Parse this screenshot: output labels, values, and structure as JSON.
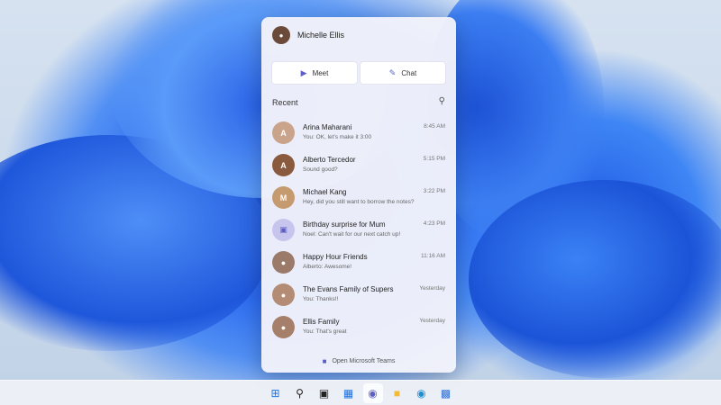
{
  "profile": {
    "name": "Michelle Ellis",
    "avatar_icon": "user-avatar-icon"
  },
  "actions": {
    "meet_label": "Meet",
    "meet_icon": "video-camera-icon",
    "chat_label": "Chat",
    "chat_icon": "compose-icon"
  },
  "recent": {
    "label": "Recent",
    "search_icon": "search-icon"
  },
  "conversations": [
    {
      "title": "Arina Maharani",
      "preview": "You: OK, let's make it 3:00",
      "time": "8:45 AM",
      "avatar_color": "#c9a48a",
      "avatar_icon": "user-avatar-icon"
    },
    {
      "title": "Alberto Tercedor",
      "preview": "Sound good?",
      "time": "5:15 PM",
      "avatar_color": "#8a5a3e",
      "avatar_icon": "user-avatar-icon"
    },
    {
      "title": "Michael Kang",
      "preview": "Hey, did you still want to borrow the notes?",
      "time": "3:22 PM",
      "avatar_color": "#c59a6e",
      "avatar_icon": "user-avatar-icon"
    },
    {
      "title": "Birthday surprise for Mum",
      "preview": "Noel: Can't wait for our next catch up!",
      "time": "4:23 PM",
      "avatar_color": "#c7c5ee",
      "avatar_icon": "calendar-icon"
    },
    {
      "title": "Happy Hour Friends",
      "preview": "Alberto: Awesome!",
      "time": "11:16 AM",
      "avatar_color": "#9b7a6a",
      "avatar_icon": "group-avatar-icon"
    },
    {
      "title": "The Evans Family of Supers",
      "preview": "You: Thanks!!",
      "time": "Yesterday",
      "avatar_color": "#b48b74",
      "avatar_icon": "group-avatar-icon"
    },
    {
      "title": "Ellis Family",
      "preview": "You: That's great",
      "time": "Yesterday",
      "avatar_color": "#a67f6a",
      "avatar_icon": "group-avatar-icon"
    }
  ],
  "footer": {
    "label": "Open Microsoft Teams",
    "icon": "teams-icon"
  },
  "taskbar": [
    {
      "name": "start-icon",
      "color": "#1a73e8"
    },
    {
      "name": "search-icon",
      "color": "#222222"
    },
    {
      "name": "task-view-icon",
      "color": "#222222"
    },
    {
      "name": "widgets-icon",
      "color": "#1a73e8"
    },
    {
      "name": "chat-icon",
      "color": "#5b5fc7",
      "active": true
    },
    {
      "name": "file-explorer-icon",
      "color": "#f2b93b"
    },
    {
      "name": "edge-icon",
      "color": "#1e8fd6"
    },
    {
      "name": "store-icon",
      "color": "#2f6fd6"
    }
  ],
  "colors": {
    "accent": "#5b5fc7",
    "wallpaper_blue": "#2b6af0"
  }
}
